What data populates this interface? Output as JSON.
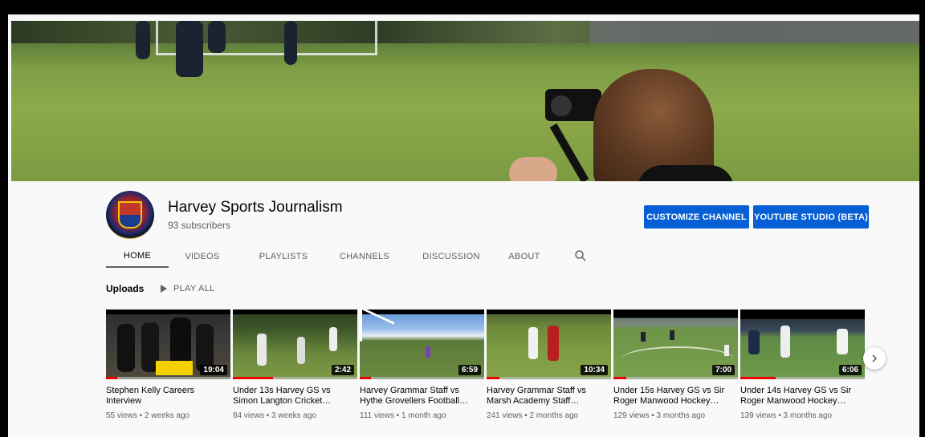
{
  "channel": {
    "name": "Harvey Sports Journalism",
    "subscribers": "93 subscribers",
    "avatar_icon": "school-crest-icon"
  },
  "buttons": {
    "customize": "CUSTOMIZE CHANNEL",
    "studio": "YOUTUBE STUDIO (BETA)"
  },
  "tabs": [
    {
      "label": "HOME",
      "active": true
    },
    {
      "label": "VIDEOS"
    },
    {
      "label": "PLAYLISTS"
    },
    {
      "label": "CHANNELS"
    },
    {
      "label": "DISCUSSION"
    },
    {
      "label": "ABOUT"
    }
  ],
  "shelf": {
    "title": "Uploads",
    "play_all": "PLAY ALL"
  },
  "videos": [
    {
      "title": "Stephen Kelly Careers Interview",
      "meta": "55 views • 2 weeks ago",
      "duration": "19:04"
    },
    {
      "title": "Under 13s Harvey GS vs Simon Langton Cricket…",
      "meta": "84 views • 3 weeks ago",
      "duration": "2:42"
    },
    {
      "title": "Harvey Grammar Staff vs Hythe Grovellers Football…",
      "meta": "111 views • 1 month ago",
      "duration": "6:59"
    },
    {
      "title": "Harvey Grammar Staff vs Marsh Academy Staff…",
      "meta": "241 views • 2 months ago",
      "duration": "10:34"
    },
    {
      "title": "Under 15s Harvey GS vs Sir Roger Manwood Hockey…",
      "meta": "129 views • 3 months ago",
      "duration": "7:00"
    },
    {
      "title": "Under 14s Harvey GS vs Sir Roger Manwood Hockey…",
      "meta": "139 views • 3 months ago",
      "duration": "6:06"
    }
  ],
  "colors": {
    "accent": "#065fd4",
    "progress": "#ee0000"
  }
}
